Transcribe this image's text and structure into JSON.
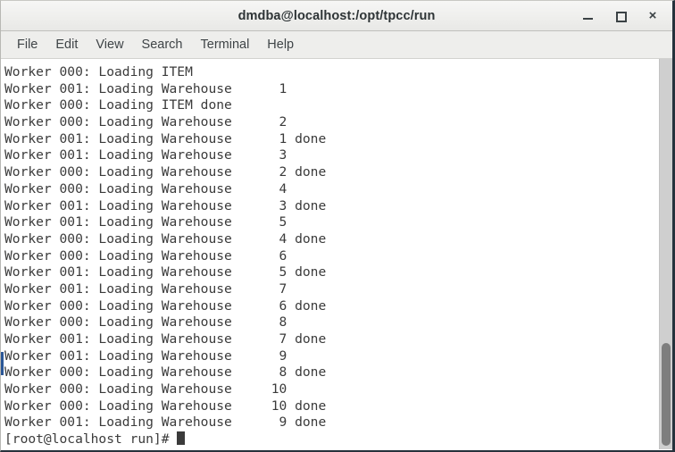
{
  "window": {
    "title": "dmdba@localhost:/opt/tpcc/run",
    "controls": {
      "minimize": "minimize",
      "maximize": "maximize",
      "close": "×"
    }
  },
  "menubar": {
    "items": [
      {
        "label": "File"
      },
      {
        "label": "Edit"
      },
      {
        "label": "View"
      },
      {
        "label": "Search"
      },
      {
        "label": "Terminal"
      },
      {
        "label": "Help"
      }
    ]
  },
  "terminal": {
    "colors": {
      "background": "#ffffff",
      "foreground": "#3b3b3b",
      "accent": "#2b5797",
      "scrollbar_thumb": "#7e7e7e",
      "scrollbar_track": "#cfcfcf"
    },
    "lines": [
      "Worker 000: Loading ITEM",
      "Worker 001: Loading Warehouse      1",
      "Worker 000: Loading ITEM done",
      "Worker 000: Loading Warehouse      2",
      "Worker 001: Loading Warehouse      1 done",
      "Worker 001: Loading Warehouse      3",
      "Worker 000: Loading Warehouse      2 done",
      "Worker 000: Loading Warehouse      4",
      "Worker 001: Loading Warehouse      3 done",
      "Worker 001: Loading Warehouse      5",
      "Worker 000: Loading Warehouse      4 done",
      "Worker 000: Loading Warehouse      6",
      "Worker 001: Loading Warehouse      5 done",
      "Worker 001: Loading Warehouse      7",
      "Worker 000: Loading Warehouse      6 done",
      "Worker 000: Loading Warehouse      8",
      "Worker 001: Loading Warehouse      7 done",
      "Worker 001: Loading Warehouse      9",
      "Worker 000: Loading Warehouse      8 done",
      "Worker 000: Loading Warehouse     10",
      "Worker 000: Loading Warehouse     10 done",
      "Worker 001: Loading Warehouse      9 done"
    ],
    "prompt": "[root@localhost run]# ",
    "cursor": "block"
  }
}
